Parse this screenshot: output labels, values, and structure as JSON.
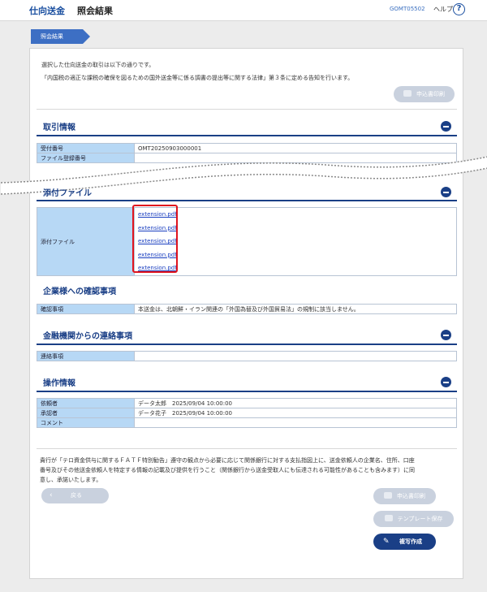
{
  "header": {
    "crumb_main": "仕向送金",
    "crumb_current": "照会結果",
    "screen_id": "GOMT05502",
    "help_label": "ヘルプ",
    "help_icon_glyph": "?"
  },
  "step_tab": "照会結果",
  "intro": {
    "line1": "選択した仕向送金の取引は以下の通りです。",
    "line2": "「内国税の適正な課税の確保を図るための国外送金等に係る調書の提出等に関する法律」第３条に定める告知を行います。",
    "print_button": "申込書印刷"
  },
  "transaction": {
    "title": "取引情報",
    "rows": [
      {
        "label": "受付番号",
        "value": "OMT20250903000001"
      },
      {
        "label": "ファイル登録番号",
        "value": ""
      }
    ]
  },
  "attachments": {
    "title": "添付ファイル",
    "label": "添付ファイル",
    "files": [
      "extension.pdf",
      "extension.pdf",
      "extension.pdf",
      "extension.pdf",
      "extension.pdf"
    ]
  },
  "confirmation": {
    "title": "企業様への確認事項",
    "label": "確認事項",
    "value": "本送金は、北朝鮮・イラン関連の「外国為替及び外国貿易法」の規制に該当しません。"
  },
  "bank_contact": {
    "title": "金融機関からの連絡事項",
    "label": "連絡事項",
    "value": ""
  },
  "operation": {
    "title": "操作情報",
    "rows": [
      {
        "label": "依頼者",
        "value": "データ太郎　2025/09/04 10:00:00"
      },
      {
        "label": "承認者",
        "value": "データ花子　2025/09/04 10:00:00"
      },
      {
        "label": "コメント",
        "value": ""
      }
    ]
  },
  "notice": {
    "line1": "貴行が「テロ資金供与に関するＦＡＴＦ特別勧告」遵守の観点から必要に応じて関係銀行に対する支払指図上に、送金依頼人の企業名、住所、口座",
    "line2": "番号及びその他送金依頼人を特定する情報の記載及び提供を行うこと（関係銀行から送金受取人にも伝達される可能性があることも含みます）に同",
    "line3": "意し、承諾いたします。"
  },
  "buttons": {
    "back": "戻る",
    "print": "申込書印刷",
    "template_save": "テンプレート保存",
    "copy_create": "複写作成"
  },
  "colors": {
    "accent": "#1a3f86",
    "link": "#1a3fc0",
    "highlight": "#e0141e",
    "label_bg": "#b7d8f5",
    "disabled_button": "#c9d1de"
  }
}
